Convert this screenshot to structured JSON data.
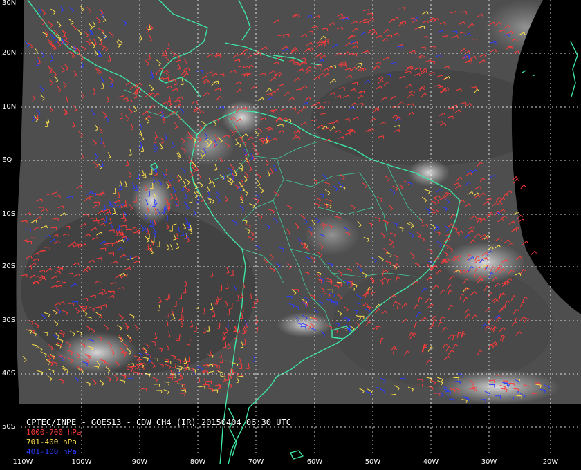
{
  "caption": "CPTEC/INPE - GOES13 - CDW CH4 (IR) 20150404 06:30 UTC",
  "legend": [
    {
      "label": "1000-700 hPa",
      "color": "#ff3b3b"
    },
    {
      "label": "701-400 hPa",
      "color": "#ffe14a"
    },
    {
      "label": "401-100 hPa",
      "color": "#2a3cff"
    }
  ],
  "lat_labels": [
    "30N",
    "20N",
    "10N",
    "EQ",
    "10S",
    "20S",
    "30S",
    "40S",
    "50S"
  ],
  "lon_labels": [
    "110W",
    "100W",
    "90W",
    "80W",
    "70W",
    "60W",
    "50W",
    "40W",
    "30W",
    "20W"
  ],
  "colors": {
    "background": "#000000",
    "coastline": "#3ee6a4",
    "grid": "#ffffff",
    "cloud_base": "#4a4a4a"
  }
}
